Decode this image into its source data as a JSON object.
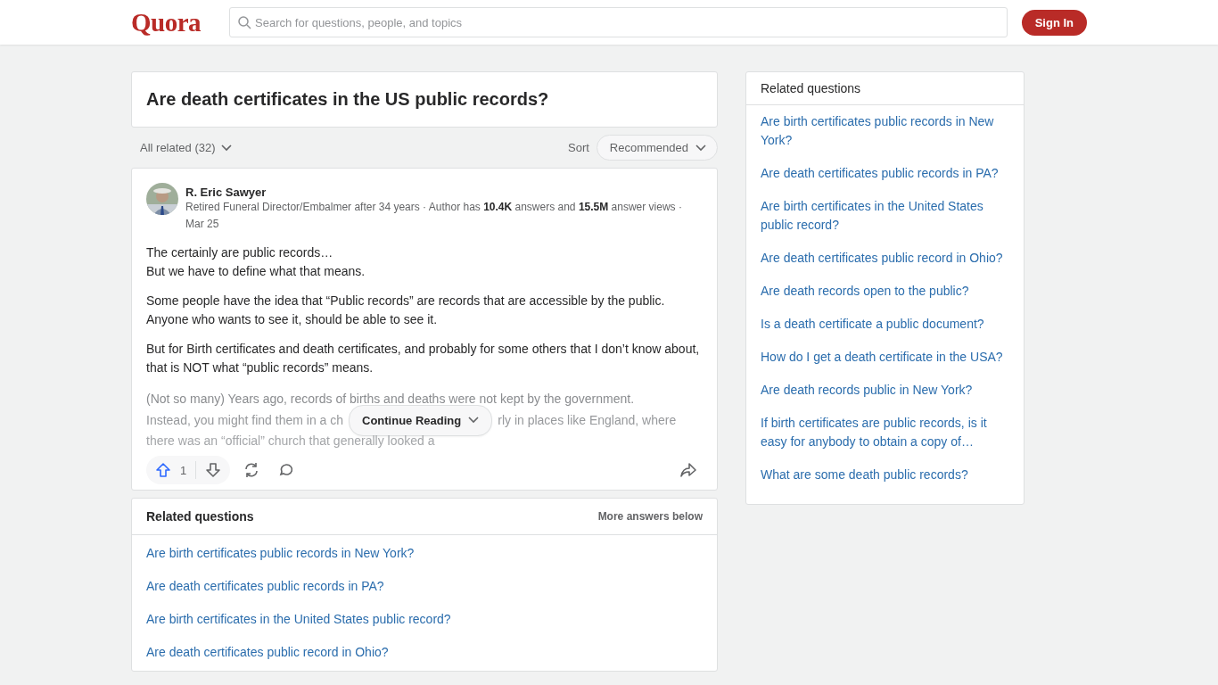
{
  "header": {
    "logo": "Quora",
    "search": {
      "placeholder": "Search for questions, people, and topics"
    },
    "sign_in": "Sign In"
  },
  "question": {
    "title": "Are death certificates in the US public records?"
  },
  "filter": {
    "all_related": "All related (32)",
    "sort_label": "Sort",
    "sort_value": "Recommended"
  },
  "answer": {
    "author": "R. Eric Sawyer",
    "credential": "Retired Funeral Director/Embalmer after 34 years · Author has **10.4K** answers and **15.5M** answer views · Mar 25",
    "paragraphs": [
      [
        "The certainly are public records…",
        "But we have to define what that means."
      ],
      [
        "Some people have the idea that “Public records” are records that are accessible by the public. Anyone who wants to see it, should be able to see it."
      ],
      [
        "But for Birth certificates and death certificates, and probably for some others that I don’t know about, that is NOT what “public records” means."
      ]
    ],
    "faded": {
      "line_1": "(Not so many) Years ago, records of births and deaths were not kept by the government.",
      "line_2_left": "Instead, you might find them in a ch",
      "line_2_right": "rly in places like England, where",
      "line_3": "there was an “official” church that generally looked a"
    },
    "continue": "Continue Reading",
    "upvotes": "1",
    "upvoted": true
  },
  "related_main": {
    "title": "Related questions",
    "note": "More answers below",
    "items": [
      "Are birth certificates public records in New York?",
      "Are death certificates public records in PA?",
      "Are birth certificates in the United States public record?",
      "Are death certificates public record in Ohio?"
    ]
  },
  "related_side": {
    "title": "Related questions",
    "items": [
      "Are birth certificates public records in New York?",
      "Are death certificates public records in PA?",
      "Are birth certificates in the United States public record?",
      "Are death certificates public record in Ohio?",
      "Are death records open to the public?",
      "Is a death certificate a public document?",
      "How do I get a death certificate in the USA?",
      "Are death records public in New York?",
      "If birth certificates are public records, is it easy for anybody to obtain a copy of…",
      "What are some death public records?"
    ]
  }
}
